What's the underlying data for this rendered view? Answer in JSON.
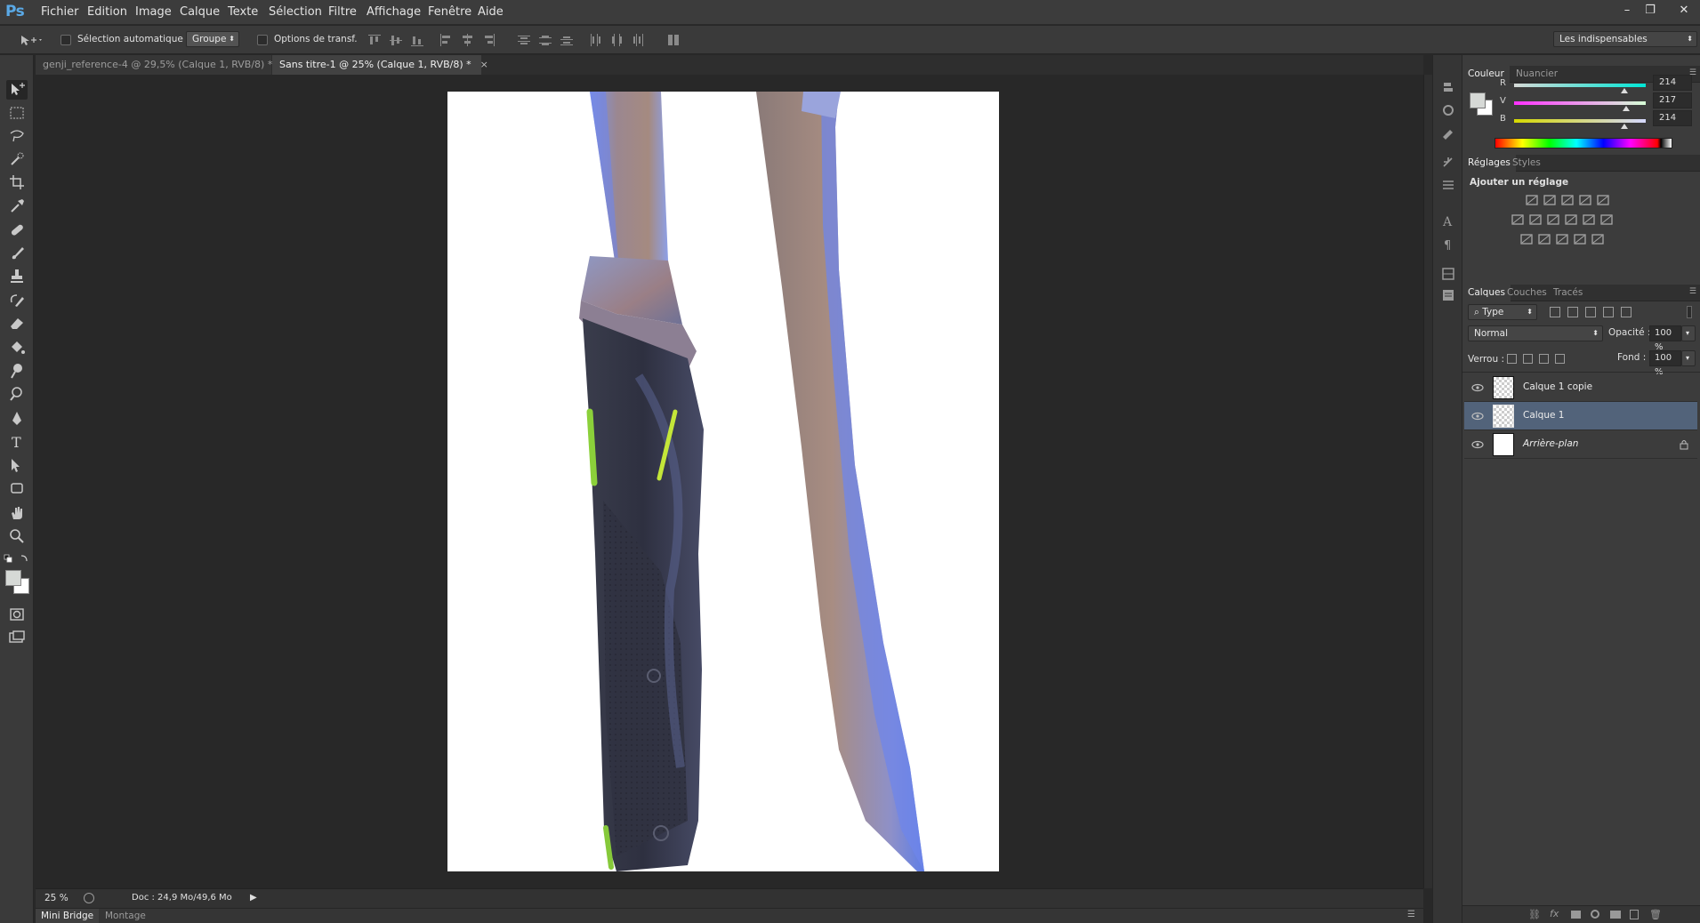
{
  "app": {
    "logo": "Ps",
    "menu": [
      "Fichier",
      "Edition",
      "Image",
      "Calque",
      "Texte",
      "Sélection",
      "Filtre",
      "Affichage",
      "Fenêtre",
      "Aide"
    ]
  },
  "window_controls": {
    "minimize": "–",
    "restore": "❐",
    "close": "✕"
  },
  "options_bar": {
    "auto_select_label": "Sélection automatique :",
    "auto_select_target": "Groupe",
    "transform_options_label": "Options de transf.",
    "workspace_preset": "Les indispensables"
  },
  "tabs": [
    {
      "label": "genji_reference-4 @ 29,5% (Calque 1, RVB/8) *",
      "close": "×"
    },
    {
      "label": "Sans titre-1 @ 25% (Calque 1, RVB/8) *",
      "close": "×"
    }
  ],
  "status": {
    "zoom": "25 %",
    "doc": "Doc : 24,9 Mo/49,6 Mo"
  },
  "bottom_tabs": [
    "Mini Bridge",
    "Montage"
  ],
  "color_panel": {
    "tabs": [
      "Couleur",
      "Nuancier"
    ],
    "channels": [
      {
        "label": "R",
        "value": "214",
        "level": 0.84,
        "gradient": "#d6d9d6,#00e6d6"
      },
      {
        "label": "V",
        "value": "217",
        "level": 0.85,
        "gradient": "#ff30ff,#d6ffd6"
      },
      {
        "label": "B",
        "value": "214",
        "level": 0.84,
        "gradient": "#d6d900,#d6d9ff"
      }
    ],
    "fg_color": "#d6d9d6"
  },
  "adjust_panel": {
    "tabs": [
      "Réglages",
      "Styles"
    ],
    "heading": "Ajouter un réglage"
  },
  "layers_panel": {
    "tabs": [
      "Calques",
      "Couches",
      "Tracés"
    ],
    "filter_kind": "Type",
    "blend_mode": "Normal",
    "opacity_label": "Opacité :",
    "opacity_value": "100 %",
    "lock_label": "Verrou :",
    "fill_label": "Fond :",
    "fill_value": "100 %",
    "layers": [
      {
        "name": "Calque 1 copie",
        "selected": false,
        "locked": false
      },
      {
        "name": "Calque 1",
        "selected": true,
        "locked": false
      },
      {
        "name": "Arrière-plan",
        "selected": false,
        "locked": true
      }
    ]
  }
}
